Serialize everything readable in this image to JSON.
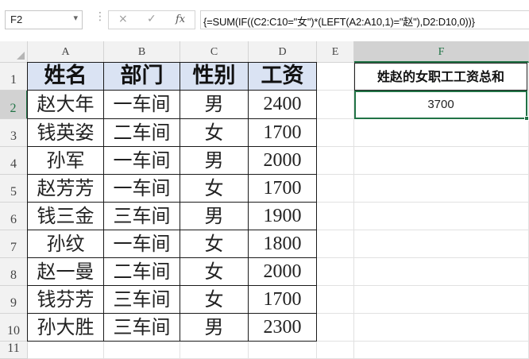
{
  "formula_bar": {
    "name_box": "F2",
    "dropdown_icon": "chevron-down-icon",
    "cancel_icon": "×",
    "enter_icon": "✓",
    "fx_label": "fx",
    "formula": "{=SUM(IF((C2:C10=\"女\")*(LEFT(A2:A10,1)=\"赵\"),D2:D10,0))}"
  },
  "columns": [
    "A",
    "B",
    "C",
    "D",
    "E",
    "F"
  ],
  "rows": [
    "1",
    "2",
    "3",
    "4",
    "5",
    "6",
    "7",
    "8",
    "9",
    "10",
    "11"
  ],
  "table": {
    "headers": [
      "姓名",
      "部门",
      "性别",
      "工资"
    ],
    "rows": [
      [
        "赵大年",
        "一车间",
        "男",
        "2400"
      ],
      [
        "钱英姿",
        "二车间",
        "女",
        "1700"
      ],
      [
        "孙军",
        "一车间",
        "男",
        "2000"
      ],
      [
        "赵芳芳",
        "一车间",
        "女",
        "1700"
      ],
      [
        "钱三金",
        "三车间",
        "男",
        "1900"
      ],
      [
        "孙纹",
        "一车间",
        "女",
        "1800"
      ],
      [
        "赵一曼",
        "二车间",
        "女",
        "2000"
      ],
      [
        "钱芬芳",
        "三车间",
        "女",
        "1700"
      ],
      [
        "孙大胜",
        "三车间",
        "男",
        "2300"
      ]
    ]
  },
  "result": {
    "label": "姓赵的女职工工资总和",
    "value": "3700"
  },
  "colors": {
    "header_fill": "#dae3f3",
    "selection": "#217346"
  }
}
